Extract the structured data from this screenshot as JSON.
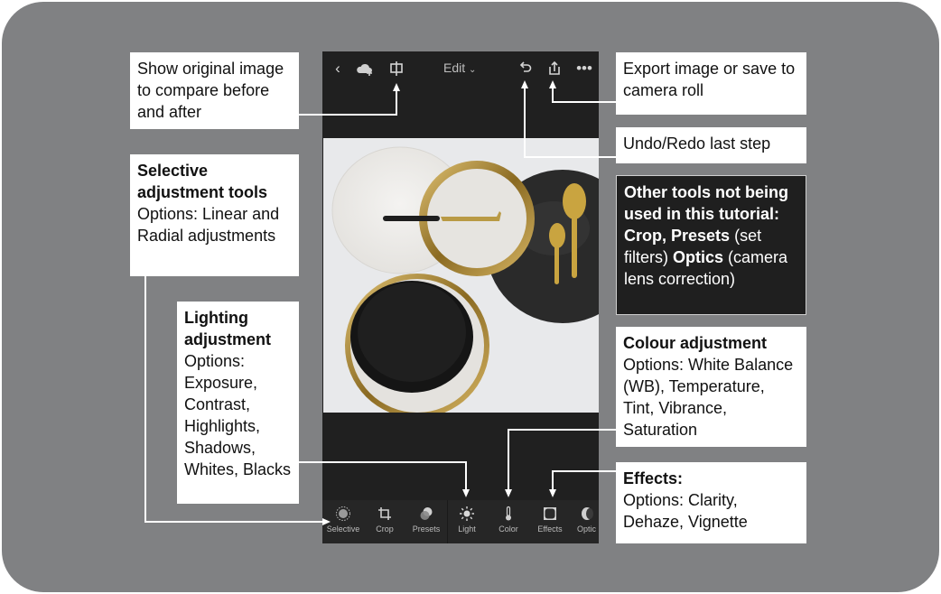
{
  "app": {
    "topbar": {
      "back_icon": "chevron-left",
      "cloud_icon": "cloud-add",
      "compare_icon": "before-after-split",
      "edit_label": "Edit",
      "edit_dropdown_icon": "chevron-down",
      "undo_icon": "undo-arrow",
      "share_icon": "share-export",
      "more_icon": "ellipsis"
    },
    "photo": {
      "description": "Flat-lay of white, gold-rimmed and black plates with gold cheese knife and spoons"
    },
    "toolbar": {
      "tools": [
        {
          "label": "Selective",
          "icon": "selective-radial"
        },
        {
          "label": "Crop",
          "icon": "crop"
        },
        {
          "label": "Presets",
          "icon": "presets-circles"
        },
        {
          "label": "Light",
          "icon": "sun"
        },
        {
          "label": "Color",
          "icon": "thermometer"
        },
        {
          "label": "Effects",
          "icon": "vignette-square"
        },
        {
          "label": "Optic",
          "icon": "lens"
        }
      ]
    }
  },
  "callouts": {
    "compare": "Show original image to compare before and after",
    "selective": {
      "title": "Selective adjustment tools",
      "body": "Options: Linear and Radial adjustments"
    },
    "lighting": {
      "title": "Lighting adjustment",
      "body": "Options: Exposure, Contrast, Highlights, Shadows, Whites, Blacks"
    },
    "export": "Export image or save to camera roll",
    "undo": "Undo/Redo last step",
    "other": {
      "intro": "Other tools not being used in this tutorial: Crop,",
      "presets_bold": "Presets",
      "presets_note": "(set filters)",
      "optics_bold": "Optics",
      "optics_note": "(camera lens correction)"
    },
    "colour": {
      "title": "Colour adjustment",
      "body": "Options: White Balance (WB), Temperature, Tint, Vibrance, Saturation"
    },
    "effects": {
      "title": "Effects:",
      "body": "Options: Clarity, Dehaze, Vignette"
    }
  },
  "colors": {
    "frame": "#808183",
    "phone_bg": "#202020",
    "callout_bg": "#ffffff",
    "callout_dark_bg": "#1f1f1f",
    "gold": "#b8953a"
  }
}
